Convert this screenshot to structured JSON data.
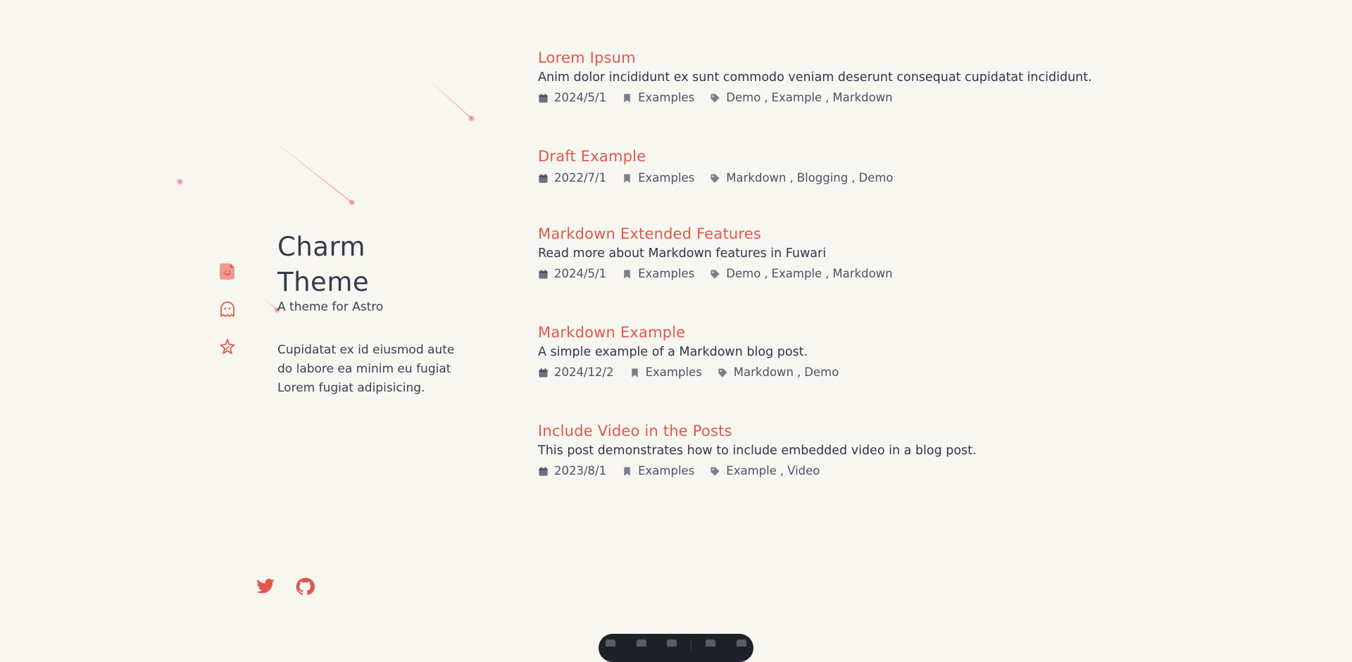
{
  "site": {
    "title": "Charm Theme",
    "subtitle": "A theme for Astro",
    "description": "Cupidatat ex id eiusmod aute do labore ea minim eu fugiat Lorem fugiat adipisicing."
  },
  "nav": [
    {
      "icon": "post-icon"
    },
    {
      "icon": "ghost-icon"
    },
    {
      "icon": "sparkle-icon"
    }
  ],
  "social": [
    {
      "icon": "twitter-icon"
    },
    {
      "icon": "github-icon"
    }
  ],
  "posts": [
    {
      "title": "Lorem Ipsum",
      "description": "Anim dolor incididunt ex sunt commodo veniam deserunt consequat cupidatat incididunt.",
      "date": "2024/5/1",
      "category": "Examples",
      "tags": [
        "Demo",
        "Example",
        "Markdown"
      ]
    },
    {
      "title": "Draft Example",
      "description": "",
      "date": "2022/7/1",
      "category": "Examples",
      "tags": [
        "Markdown",
        "Blogging",
        "Demo"
      ]
    },
    {
      "title": "Markdown Extended Features",
      "description": "Read more about Markdown features in Fuwari",
      "date": "2024/5/1",
      "category": "Examples",
      "tags": [
        "Demo",
        "Example",
        "Markdown"
      ]
    },
    {
      "title": "Markdown Example",
      "description": "A simple example of a Markdown blog post.",
      "date": "2024/12/2",
      "category": "Examples",
      "tags": [
        "Markdown",
        "Demo"
      ]
    },
    {
      "title": "Include Video in the Posts",
      "description": "This post demonstrates how to include embedded video in a blog post.",
      "date": "2023/8/1",
      "category": "Examples",
      "tags": [
        "Example",
        "Video"
      ]
    }
  ],
  "colors": {
    "accent": "#e1574c",
    "background": "#f8f6f1",
    "text": "#30354a",
    "meta_icon": "#7a7f8c",
    "dock": "#1f2128"
  }
}
